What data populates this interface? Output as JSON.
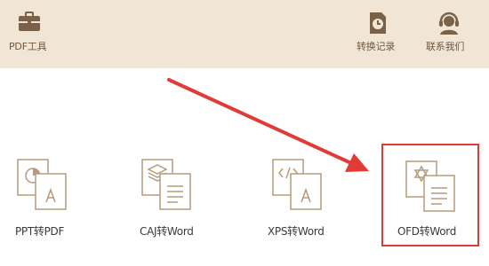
{
  "toolbar": {
    "pdf_tools": {
      "label": "PDF工具",
      "icon": "briefcase-icon"
    },
    "history": {
      "label": "转换记录",
      "icon": "clock-document-icon"
    },
    "contact": {
      "label": "联系我们",
      "icon": "customer-service-icon"
    }
  },
  "tools": [
    {
      "label": "PPT转PDF",
      "icon": "ppt-to-pdf-icon"
    },
    {
      "label": "CAJ转Word",
      "icon": "caj-to-word-icon"
    },
    {
      "label": "XPS转Word",
      "icon": "xps-to-word-icon"
    },
    {
      "label": "OFD转Word",
      "icon": "ofd-to-word-icon",
      "highlighted": true
    }
  ],
  "colors": {
    "toolbar_bg": "#f1e6d6",
    "toolbar_icon": "#7a6148",
    "tool_icon_stroke": "#b59b7c",
    "highlight": "#e23b36"
  }
}
